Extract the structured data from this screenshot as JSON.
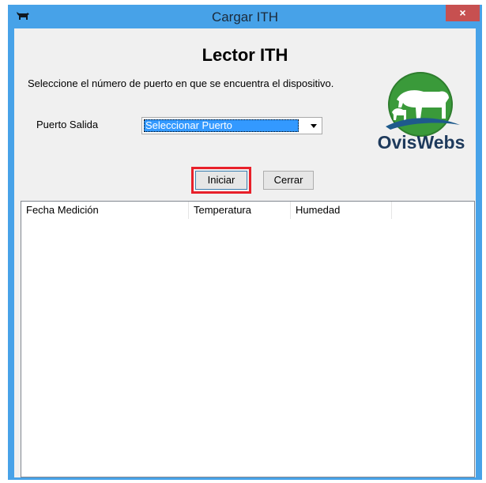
{
  "window": {
    "title": "Cargar ITH",
    "close_glyph": "×"
  },
  "form": {
    "heading": "Lector ITH",
    "instruction": "Seleccione el número de puerto en que se encuentra el dispositivo.",
    "port_label": "Puerto Salida",
    "port_select_value": "Seleccionar Puerto",
    "logo_text": "OvisWebs"
  },
  "buttons": {
    "start": "Iniciar",
    "close": "Cerrar"
  },
  "table": {
    "columns": [
      "Fecha Medición",
      "Temperatura",
      "Humedad"
    ]
  },
  "colors": {
    "titlebar": "#47a2e8",
    "highlight": "#e8202a",
    "logo_green": "#3a9a3a",
    "logo_blue": "#1e5a8c"
  }
}
